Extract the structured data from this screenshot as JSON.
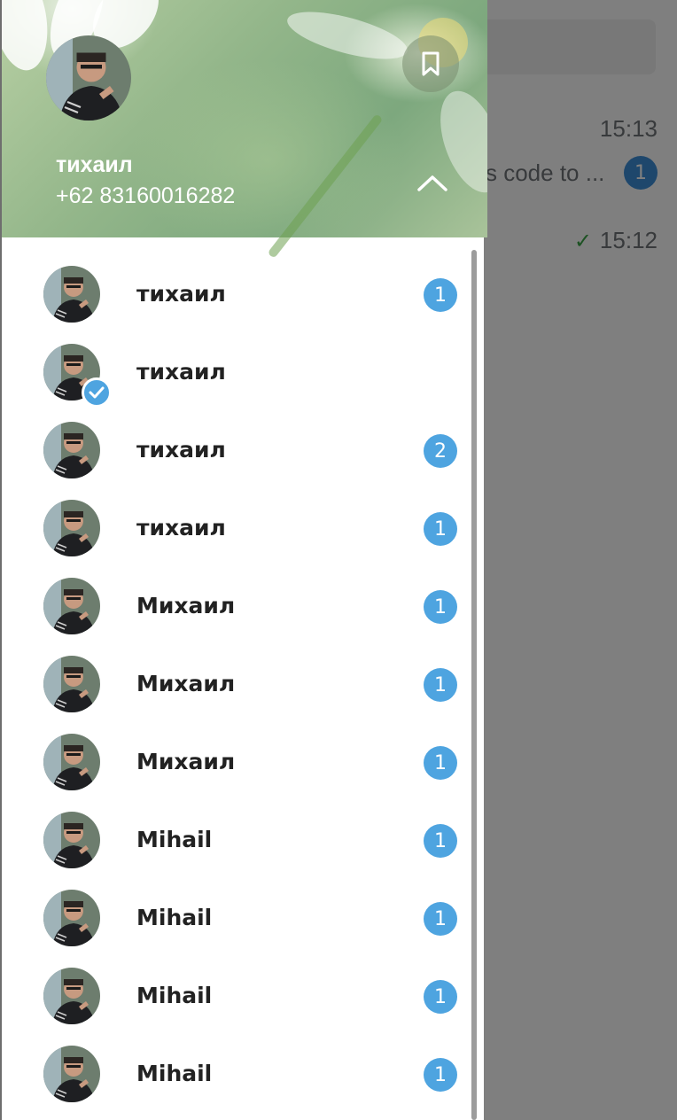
{
  "background": {
    "time1": "15:13",
    "snippet": "s code to ...",
    "unread": "1",
    "time2": "15:12"
  },
  "header": {
    "name": "тихаил",
    "phone": "+62 83160016282",
    "bookmark_icon": "bookmark-icon",
    "collapse_icon": "chevron-up-icon"
  },
  "accounts": [
    {
      "name": "тихаил",
      "badge": "1",
      "verified": false
    },
    {
      "name": "тихаил",
      "badge": "",
      "verified": true
    },
    {
      "name": "тихаил",
      "badge": "2",
      "verified": false
    },
    {
      "name": "тихаил",
      "badge": "1",
      "verified": false
    },
    {
      "name": "Михаил",
      "badge": "1",
      "verified": false
    },
    {
      "name": "Михаил",
      "badge": "1",
      "verified": false
    },
    {
      "name": "Михаил",
      "badge": "1",
      "verified": false
    },
    {
      "name": "Mihail",
      "badge": "1",
      "verified": false
    },
    {
      "name": "Mihail",
      "badge": "1",
      "verified": false
    },
    {
      "name": "Mihail",
      "badge": "1",
      "verified": false
    },
    {
      "name": "Mihail",
      "badge": "1",
      "verified": false
    }
  ],
  "colors": {
    "badge": "#4ea4e0",
    "accent": "#3d8fd8"
  }
}
